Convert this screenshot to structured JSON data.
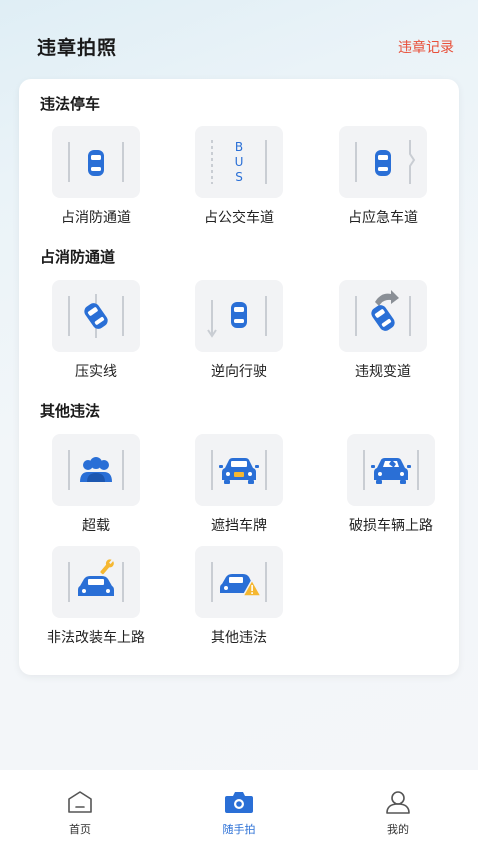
{
  "header": {
    "title": "违章拍照",
    "record_link": "违章记录"
  },
  "sections": [
    {
      "title": "违法停车",
      "items": [
        {
          "label": "占消防通道",
          "icon": "car-in-lane-icon"
        },
        {
          "label": "占公交车道",
          "icon": "bus-lane-icon",
          "lane_text": "BUS"
        },
        {
          "label": "占应急车道",
          "icon": "emergency-lane-icon"
        }
      ]
    },
    {
      "title": "占消防通道",
      "items": [
        {
          "label": "压实线",
          "icon": "car-on-solid-line-icon"
        },
        {
          "label": "逆向行驶",
          "icon": "wrong-way-icon"
        },
        {
          "label": "违规变道",
          "icon": "illegal-lane-change-icon"
        }
      ]
    },
    {
      "title": "其他违法",
      "items": [
        {
          "label": "超载",
          "icon": "overload-people-icon"
        },
        {
          "label": "遮挡车牌",
          "icon": "covered-plate-icon"
        },
        {
          "label": "破损车辆上路",
          "icon": "damaged-car-icon"
        },
        {
          "label": "非法改装车上路",
          "icon": "modified-car-icon"
        },
        {
          "label": "其他违法",
          "icon": "car-warning-icon"
        }
      ]
    }
  ],
  "tabbar": [
    {
      "label": "首页",
      "icon": "home-icon",
      "active": false
    },
    {
      "label": "随手拍",
      "icon": "camera-icon",
      "active": true
    },
    {
      "label": "我的",
      "icon": "user-icon",
      "active": false
    }
  ],
  "colors": {
    "accent_blue": "#2a6fd6",
    "link_red": "#e8503a",
    "warning_yellow": "#f5b731"
  }
}
